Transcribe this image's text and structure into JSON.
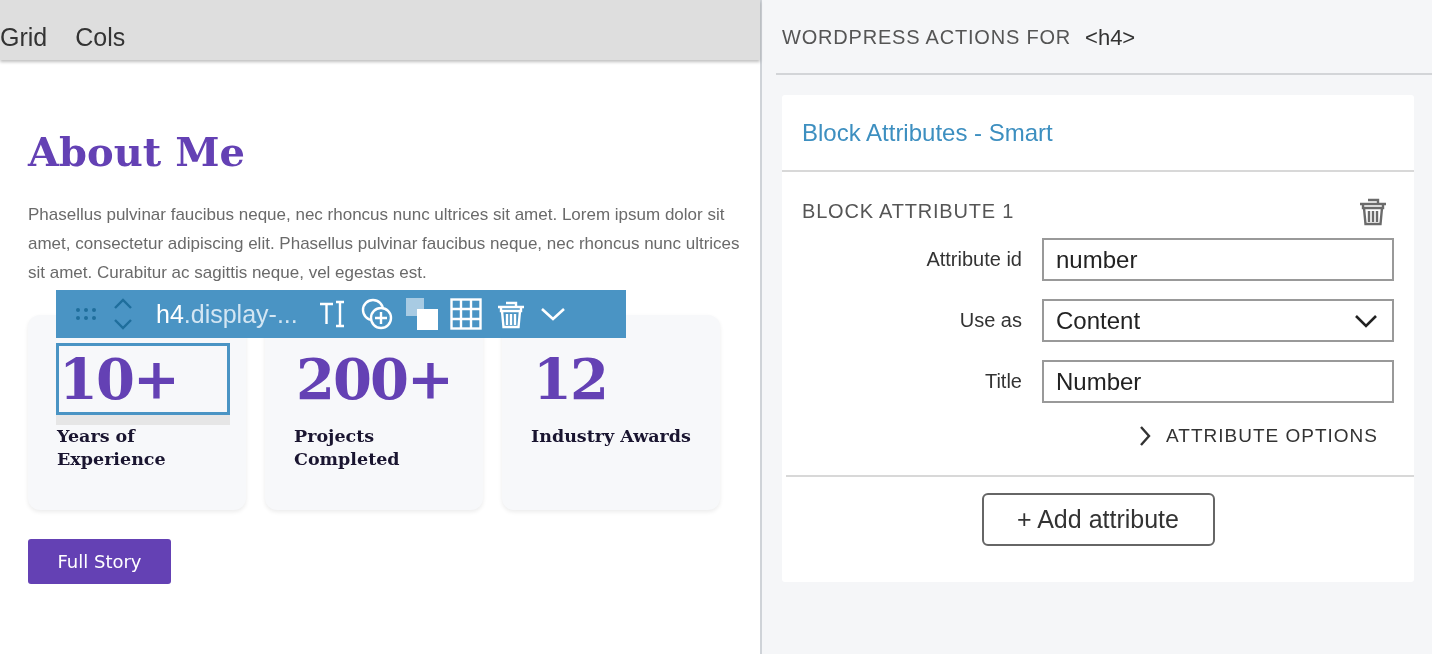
{
  "top_bar": {
    "items": [
      "Grid",
      "Cols"
    ]
  },
  "content": {
    "heading": "About Me",
    "paragraph": "Phasellus pulvinar faucibus neque, nec rhoncus nunc ultrices sit amet. Lorem ipsum dolor sit amet, consectetur adipiscing elit. Phasellus pulvinar faucibus neque, nec rhoncus nunc ultrices sit amet. Curabitur ac sagittis neque, vel egestas est.",
    "stats": [
      {
        "number": "10+",
        "label": "Years of Experience",
        "selected": true
      },
      {
        "number": "200+",
        "label": "Projects Completed",
        "selected": false
      },
      {
        "number": "12",
        "label": "Industry Awards",
        "selected": false
      }
    ],
    "button": "Full Story"
  },
  "block_toolbar": {
    "tag": "h4",
    "class_name": ".display-..."
  },
  "panel": {
    "header": "WORDPRESS ACTIONS FOR",
    "element": "<h4>",
    "card_title": "Block Attributes - Smart",
    "section_title": "BLOCK ATTRIBUTE 1",
    "fields": [
      {
        "label": "Attribute id",
        "kind": "text",
        "value": "number"
      },
      {
        "label": "Use as",
        "kind": "select",
        "value": "Content"
      },
      {
        "label": "Title",
        "kind": "text",
        "value": "Number"
      }
    ],
    "options": {
      "label": "ATTRIBUTE OPTIONS",
      "expanded": false
    },
    "add_button": "+ Add attribute"
  }
}
